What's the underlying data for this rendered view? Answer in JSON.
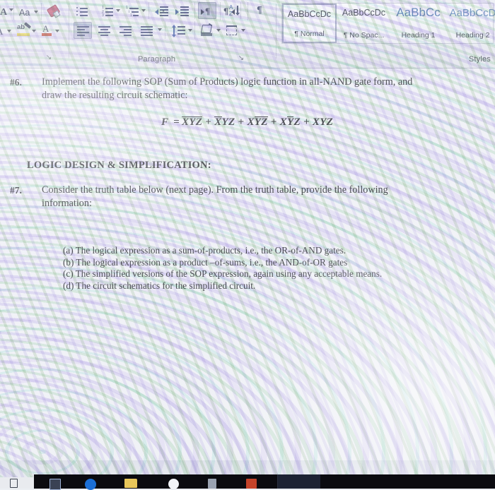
{
  "window": {
    "app": "Microsoft Word",
    "kind": "photo-of-screen"
  },
  "ribbon": {
    "groups": [
      {
        "label": "",
        "name": "font-group"
      },
      {
        "label": "Paragraph",
        "name": "paragraph-group"
      },
      {
        "label": "Styles",
        "name": "styles-group"
      }
    ],
    "font_group": {
      "label": "",
      "buttons": [
        {
          "name": "grow-font-button",
          "glyph": "A",
          "tooltip": "Increase Font Size"
        },
        {
          "name": "change-case-button",
          "glyph": "Aa",
          "tooltip": "Change Case"
        },
        {
          "name": "clear-formatting-button",
          "glyph": "eraser-icon",
          "tooltip": "Clear All Formatting"
        },
        {
          "name": "shrink-font-button",
          "glyph": "A",
          "tooltip": "Decrease Font Size"
        },
        {
          "name": "text-highlight-color-button",
          "glyph": "aby",
          "tooltip": "Text Highlight Color",
          "color": "#f3e63c"
        },
        {
          "name": "font-color-button",
          "glyph": "A",
          "tooltip": "Font Color",
          "color": "#c03a22"
        }
      ]
    },
    "paragraph_group": {
      "label": "Paragraph",
      "buttons": [
        {
          "name": "bullets-button",
          "tooltip": "Bullets"
        },
        {
          "name": "numbering-button",
          "tooltip": "Numbering"
        },
        {
          "name": "multilevel-list-button",
          "tooltip": "Multilevel List"
        },
        {
          "name": "decrease-indent-button",
          "tooltip": "Decrease Indent"
        },
        {
          "name": "increase-indent-button",
          "tooltip": "Increase Indent"
        },
        {
          "name": "ltr-text-direction-button",
          "tooltip": "Left-to-Right Text Direction",
          "active": true
        },
        {
          "name": "rtl-text-direction-button",
          "tooltip": "Right-to-Left Text Direction",
          "active": false
        },
        {
          "name": "sort-button",
          "tooltip": "Sort",
          "glyph": "AZ"
        },
        {
          "name": "show-hide-marks-button",
          "tooltip": "Show/Hide Formatting Marks",
          "glyph": "¶"
        },
        {
          "name": "align-left-button",
          "tooltip": "Align Left",
          "active": true
        },
        {
          "name": "align-center-button",
          "tooltip": "Center",
          "active": false
        },
        {
          "name": "align-right-button",
          "tooltip": "Align Right",
          "active": false
        },
        {
          "name": "justify-button",
          "tooltip": "Justify",
          "active": false
        },
        {
          "name": "line-spacing-button",
          "tooltip": "Line and Paragraph Spacing"
        },
        {
          "name": "shading-button",
          "tooltip": "Shading"
        },
        {
          "name": "borders-button",
          "tooltip": "Borders"
        }
      ],
      "dialog_launcher": "↘"
    },
    "styles_group": {
      "label": "Styles",
      "gallery": [
        {
          "preview": "AaBbCcDc",
          "name": "Normal",
          "mark": "¶",
          "selected": true,
          "accent": "#1b2030",
          "size": "12.5px"
        },
        {
          "preview": "AaBbCcDc",
          "name": "No Spac...",
          "mark": "¶",
          "selected": false,
          "accent": "#1b2030",
          "size": "12.5px"
        },
        {
          "preview": "AaBbCс",
          "name": "Heading 1",
          "mark": "",
          "selected": false,
          "accent": "#3d6ba8",
          "size": "17px"
        },
        {
          "preview": "AaBbCcD",
          "name": "Heading 2",
          "mark": "",
          "selected": false,
          "accent": "#4f7cb4",
          "size": "14.5px"
        }
      ]
    }
  },
  "document": {
    "items": [
      {
        "number": "#6.",
        "lines": [
          "Implement the following SOP (Sum of Products) logic function in all-NAND gate form, and",
          "draw the resulting circuit schematic:"
        ]
      }
    ],
    "equation": {
      "lhs": "F",
      "eq": "=",
      "terms": [
        {
          "vars": [
            {
              "ch": "X",
              "bar": true
            },
            {
              "ch": "Y",
              "bar": true
            },
            {
              "ch": "Z",
              "bar": true
            }
          ]
        },
        {
          "vars": [
            {
              "ch": "X",
              "bar": true
            },
            {
              "ch": "Y",
              "bar": false
            },
            {
              "ch": "Z",
              "bar": false
            }
          ]
        },
        {
          "vars": [
            {
              "ch": "X",
              "bar": false
            },
            {
              "ch": "Y",
              "bar": true
            },
            {
              "ch": "Z",
              "bar": true
            }
          ]
        },
        {
          "vars": [
            {
              "ch": "X",
              "bar": false
            },
            {
              "ch": "Y",
              "bar": true
            },
            {
              "ch": "Z",
              "bar": false
            }
          ]
        },
        {
          "vars": [
            {
              "ch": "X",
              "bar": false
            },
            {
              "ch": "Y",
              "bar": false
            },
            {
              "ch": "Z",
              "bar": false
            }
          ]
        }
      ],
      "plain": "F = X̄ȲZ̄ + X̄YZ + XȲZ̄ + XȲZ + XYZ"
    },
    "section_heading": "LOGIC DESIGN & SIMPLIFICATION:",
    "item7": {
      "number": "#7.",
      "lines": [
        "Consider the truth table below (next page). From the truth table, provide the following",
        "information:"
      ]
    },
    "sublist": [
      "(a)  The logical expression as a sum-of-products, i.e., the OR-of-AND gates.",
      "(b)  The logical expression as a product –of-sums, i.e., the AND-of-OR gates",
      "(c)  The simplified versions of the SOP expression, again using any acceptable means.",
      "(d)  The circuit schematics for the simplified circuit."
    ]
  },
  "taskbar": {
    "icons": [
      {
        "name": "taskview-icon",
        "color": "#d7dbe2"
      },
      {
        "name": "edge-browser-icon",
        "color": "#1b6fd6"
      },
      {
        "name": "file-explorer-icon",
        "color": "#e7c65a"
      },
      {
        "name": "search-icon",
        "color": "#f2f4f8"
      },
      {
        "name": "app-icon",
        "color": "#9aa3b2"
      },
      {
        "name": "office-app-icon",
        "color": "#c4432a"
      }
    ]
  },
  "colors": {
    "ribbon_bg": "#e9ebf0",
    "page_bg": "#f2f3f7",
    "text": "#14161c",
    "accent_heading": "#3d6ba8",
    "taskbar": "#0b0b10"
  }
}
